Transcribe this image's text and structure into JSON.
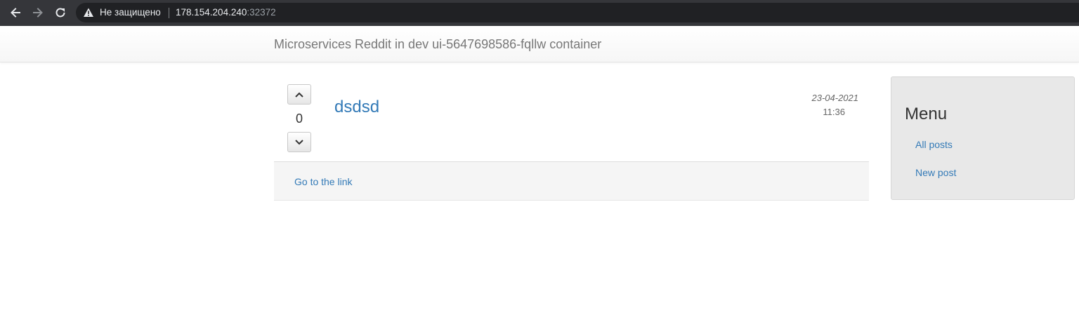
{
  "browser": {
    "security_label": "Не защищено",
    "url_host": "178.154.204.240",
    "url_port": ":32372",
    "icons": [
      "back-arrow-icon",
      "forward-arrow-icon",
      "reload-icon",
      "warning-icon"
    ]
  },
  "navbar": {
    "brand": "Microservices Reddit in dev ui-5647698586-fqllw container"
  },
  "post": {
    "votes": "0",
    "title": "dsdsd",
    "date": "23-04-2021",
    "time": "11:36",
    "link_label": "Go to the link",
    "icons": [
      "chevron-up-icon",
      "chevron-down-icon"
    ]
  },
  "sidebar": {
    "title": "Menu",
    "items": [
      {
        "label": "All posts"
      },
      {
        "label": "New post"
      }
    ]
  },
  "colors": {
    "link": "#337ab7",
    "chrome_bg": "#35363a",
    "omnibox_bg": "#202124",
    "panel_bg": "#f5f5f5",
    "sidebar_bg": "#e8e8e8"
  }
}
